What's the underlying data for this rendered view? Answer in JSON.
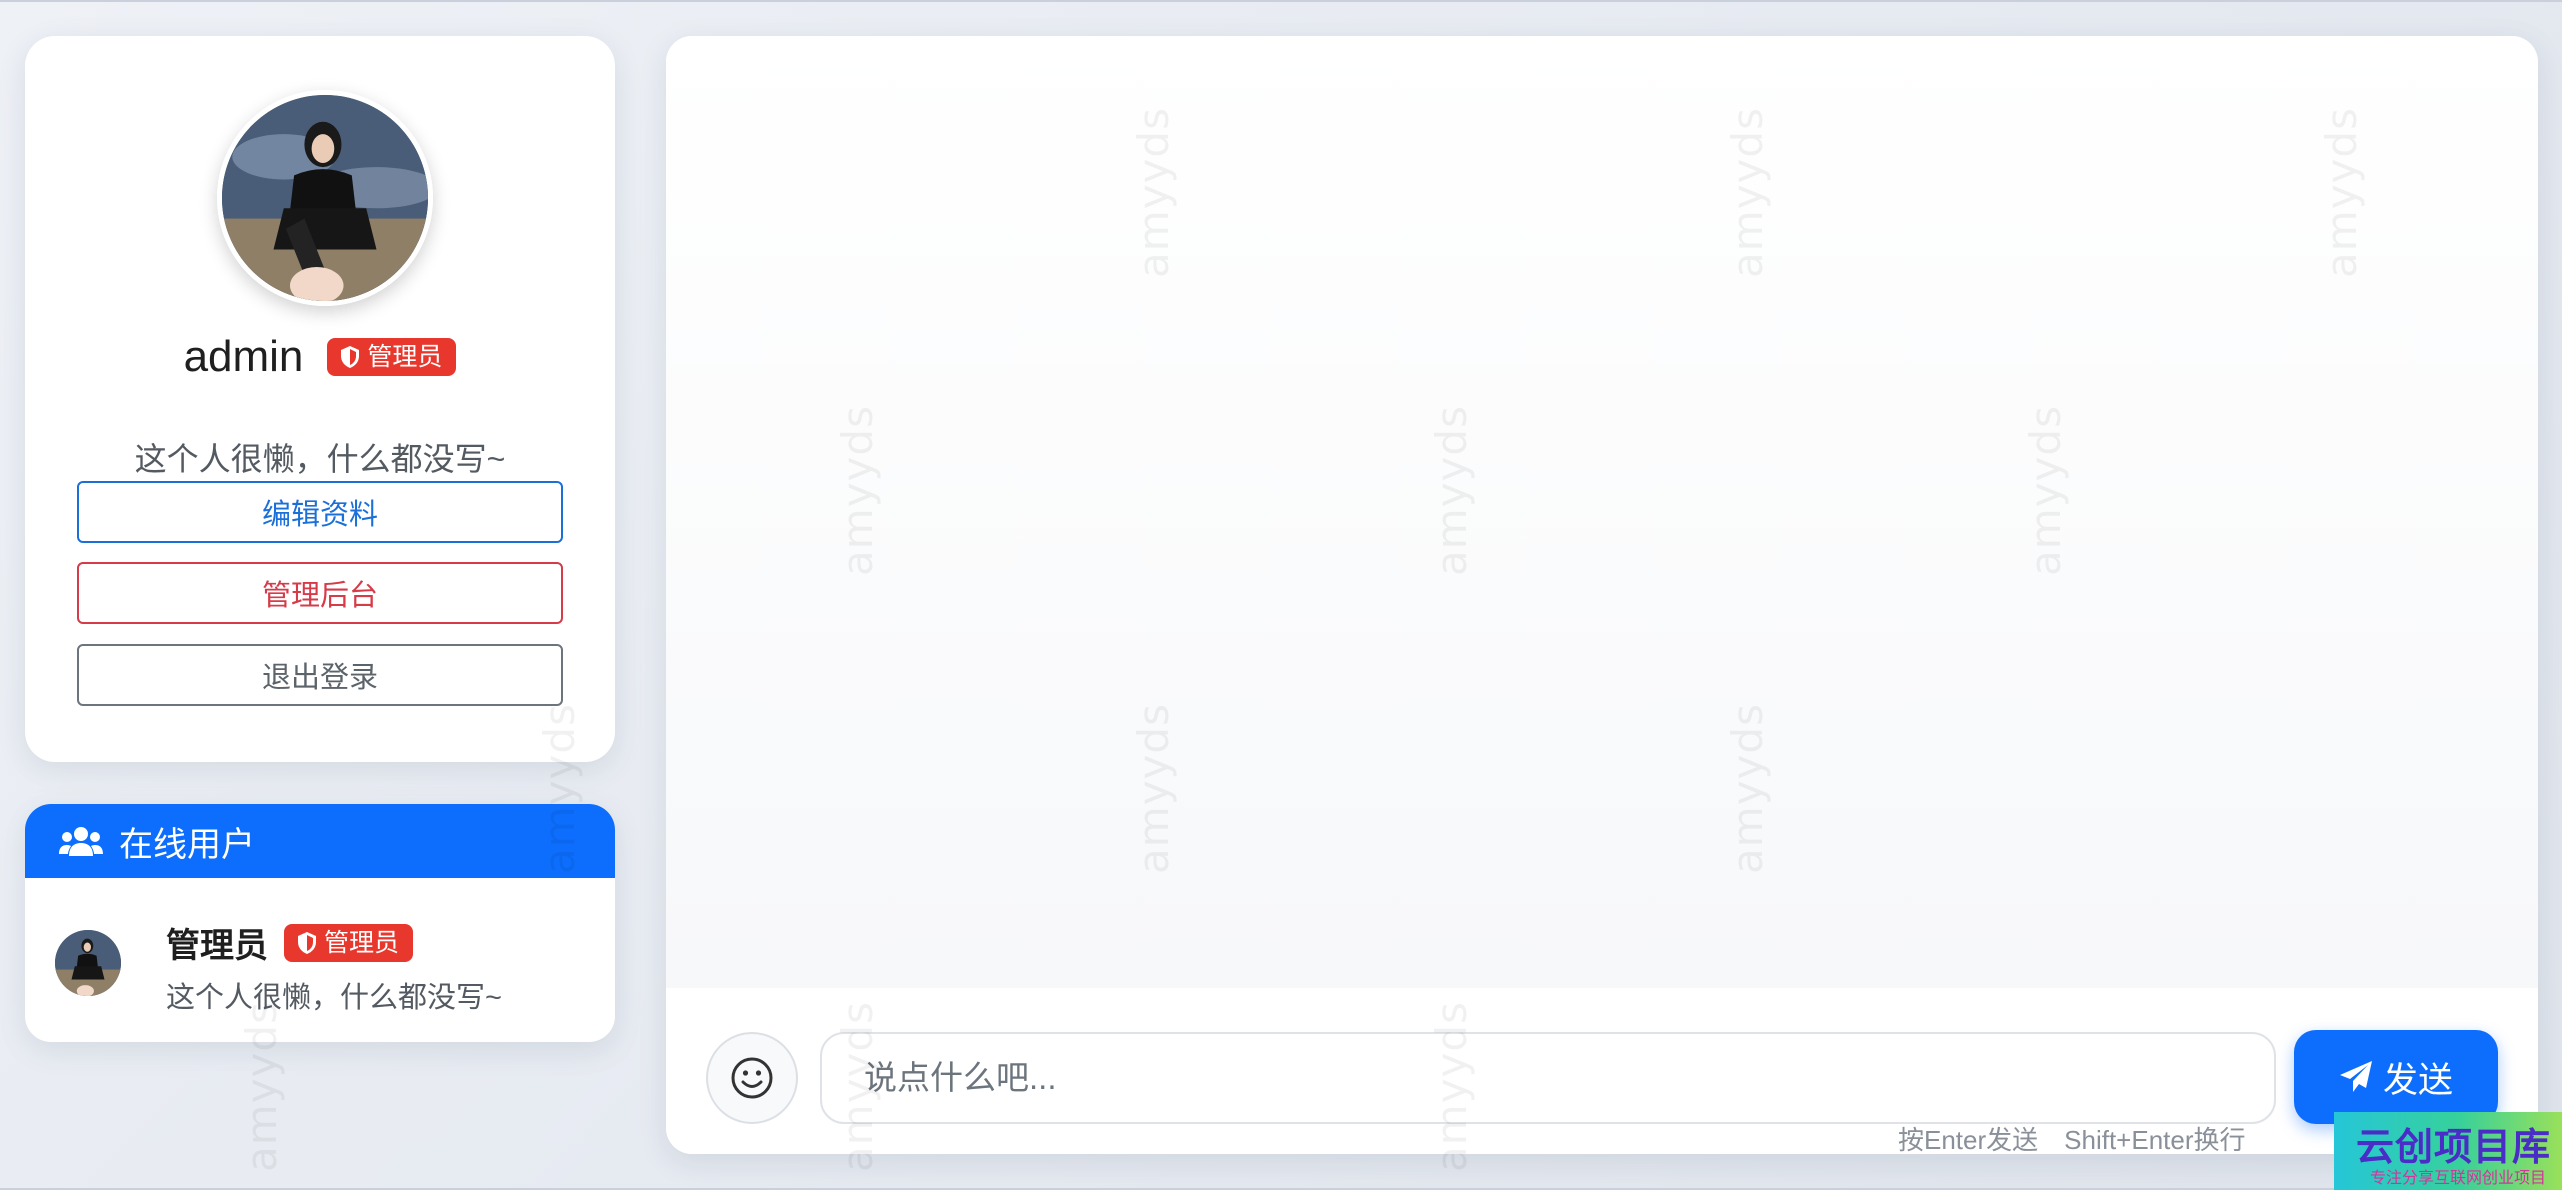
{
  "profile": {
    "username": "admin",
    "role_badge": "管理员",
    "bio": "这个人很懒，什么都没写~",
    "buttons": {
      "edit": "编辑资料",
      "admin": "管理后台",
      "logout": "退出登录"
    }
  },
  "online_users": {
    "title": "在线用户",
    "users": [
      {
        "name": "管理员",
        "badge": "管理员",
        "bio": "这个人很懒，什么都没写~"
      }
    ]
  },
  "chat": {
    "input_placeholder": "说点什么吧...",
    "send_label": "发送",
    "hint_enter": "按Enter发送",
    "hint_shift_enter": "Shift+Enter换行"
  },
  "watermark": {
    "text": "amyyds"
  },
  "corner_logo": {
    "title": "云创项目库",
    "subtitle": "专注分享互联网创业项目"
  },
  "icons": {
    "role_badge": "shield-icon",
    "online_header": "users-icon",
    "emoji_button": "smile-icon",
    "send_button": "paper-plane-icon"
  },
  "colors": {
    "primary": "#0d6efd",
    "danger": "#e8382e",
    "edit_border": "#1a6fd8",
    "admin_border": "#d53b48",
    "logout_border": "#6c757d"
  }
}
